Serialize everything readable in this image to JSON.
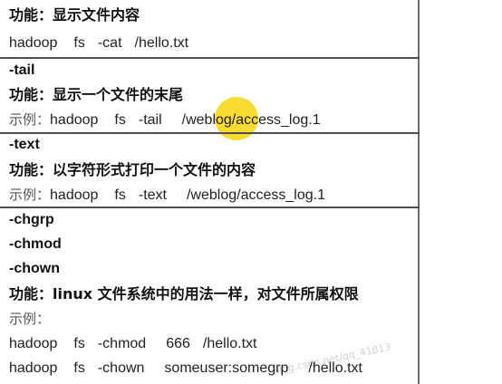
{
  "sections": {
    "cat": {
      "feature": "功能：显示文件内容",
      "cmd": [
        "hadoop",
        "fs",
        "-cat",
        "/hello.txt"
      ]
    },
    "tail": {
      "option": "-tail",
      "feature": "功能：显示一个文件的末尾",
      "example_label": "示例：",
      "cmd": [
        "hadoop",
        "fs",
        "-tail",
        "/weblog/access_log.1"
      ]
    },
    "text": {
      "option": "-text",
      "feature": "功能：以字符形式打印一个文件的内容",
      "example_label": "示例：",
      "cmd": [
        "hadoop",
        "fs",
        "-text",
        "/weblog/access_log.1"
      ]
    },
    "chown": {
      "options": [
        "-chgrp",
        "-chmod",
        "-chown"
      ],
      "feature": "功能：linux 文件系统中的用法一样，对文件所属权限",
      "example_label": "示例：",
      "cmd1": [
        "hadoop",
        "fs",
        "-chmod",
        "666",
        "/hello.txt"
      ],
      "cmd2": [
        "hadoop",
        "fs",
        "-chown",
        "someuser:somegrp",
        "/hello.txt"
      ]
    }
  },
  "watermark": "blog.csdn.net/qq_41813",
  "colors": {
    "highlight": "#f6d614",
    "rule": "#4f4f4f",
    "text": "#1b1b1b"
  }
}
